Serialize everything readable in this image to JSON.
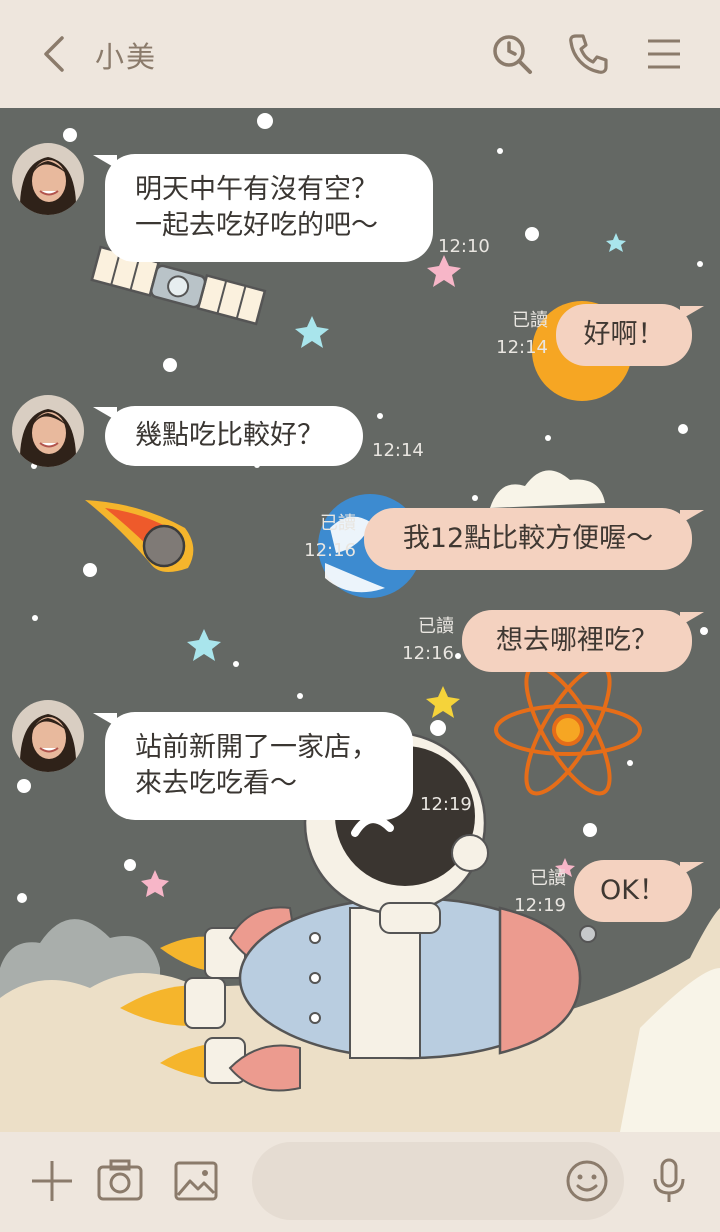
{
  "header": {
    "title": "小美",
    "icons": [
      "back-chevron-icon",
      "search-history-icon",
      "phone-icon",
      "menu-icon"
    ]
  },
  "messages": [
    {
      "side": "in",
      "text": "明天中午有沒有空？\n一起去吃好吃的吧～",
      "time": "12:10"
    },
    {
      "side": "out",
      "text": "好啊！",
      "read": "已讀",
      "time": "12:14"
    },
    {
      "side": "in",
      "text": "幾點吃比較好？",
      "time": "12:14"
    },
    {
      "side": "out",
      "text": "我12點比較方便喔～",
      "read": "已讀",
      "time": "12:16"
    },
    {
      "side": "out",
      "text": "想去哪裡吃？",
      "read": "已讀",
      "time": "12:16"
    },
    {
      "side": "in",
      "text": "站前新開了一家店，\n來去吃吃看～",
      "time": "12:19"
    },
    {
      "side": "out",
      "text": "OK！",
      "read": "已讀",
      "time": "12:19"
    }
  ],
  "footer": {
    "icons": [
      "plus-icon",
      "camera-icon",
      "image-icon",
      "emoji-icon",
      "microphone-icon"
    ],
    "input_placeholder": ""
  },
  "colors": {
    "header_bg": "#eee6dd",
    "chat_bg": "#646864",
    "incoming_bubble": "#ffffff",
    "outgoing_bubble": "#f4d2c0",
    "icon": "#8b7b6b"
  }
}
